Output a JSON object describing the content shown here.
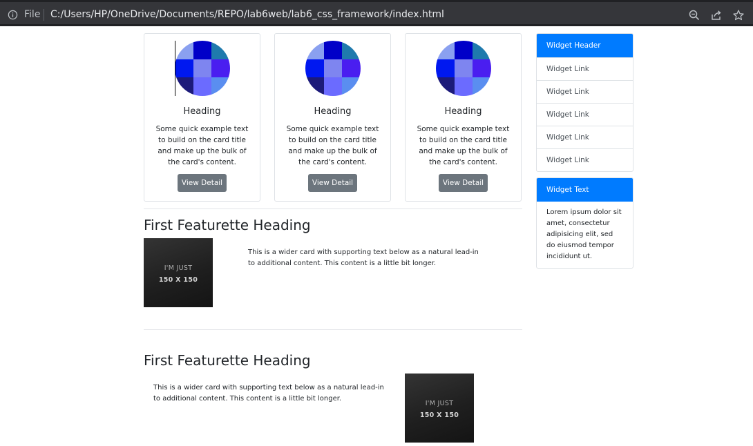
{
  "browser": {
    "file_label": "File",
    "url": "C:/Users/HP/OneDrive/Documents/REPO/lab6web/lab6_css_framework/index.html",
    "icons": [
      "info-icon",
      "zoom-out-icon",
      "share-icon",
      "star-icon"
    ]
  },
  "cards": [
    {
      "title": "Heading",
      "text": "Some quick example text to build on the card title and make up the bulk of the card's content.",
      "button": "View Detail"
    },
    {
      "title": "Heading",
      "text": "Some quick example text to build on the card title and make up the bulk of the card's content.",
      "button": "View Detail"
    },
    {
      "title": "Heading",
      "text": "Some quick example text to build on the card title and make up the bulk of the card's content.",
      "button": "View Detail"
    }
  ],
  "card_image_colors": [
    "#8aa0f0",
    "#0000c8",
    "#1f7aad",
    "#0018f0",
    "#7e85f0",
    "#4a1ef0",
    "#1c1a7a",
    "#6b6bff",
    "#5a8ef0"
  ],
  "featurettes": [
    {
      "heading": "First Featurette Heading",
      "text": "This is a wider card with supporting text below as a natural lead-in to additional content. This content is a little bit longer.",
      "image_line1": "I'M JUST",
      "image_line2": "150 X 150"
    },
    {
      "heading": "First Featurette Heading",
      "text": "This is a wider card with supporting text below as a natural lead-in to additional content. This content is a little bit longer.",
      "image_line1": "I'M JUST",
      "image_line2": "150 X 150"
    }
  ],
  "widget_links": {
    "header": "Widget Header",
    "links": [
      "Widget Link",
      "Widget Link",
      "Widget Link",
      "Widget Link",
      "Widget Link"
    ]
  },
  "widget_text": {
    "header": "Widget Text",
    "body": "Lorem ipsum dolor sit amet, consectetur adipisicing elit, sed do eiusmod tempor incididunt ut."
  },
  "colors": {
    "primary": "#007bff",
    "secondary_button": "#6c757d",
    "browser_bar": "#35363a"
  }
}
